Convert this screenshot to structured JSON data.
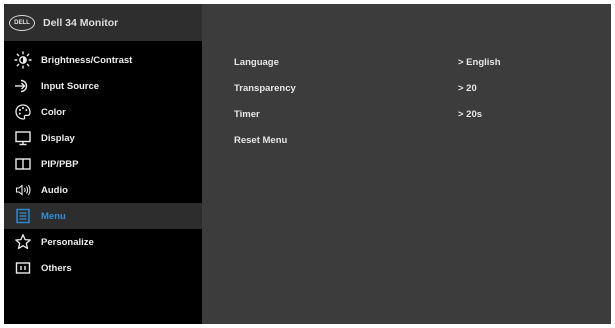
{
  "header": {
    "logo_text": "DELL",
    "title": "Dell 34 Monitor"
  },
  "sidebar": {
    "items": [
      {
        "label": "Brightness/Contrast",
        "icon": "brightness-icon"
      },
      {
        "label": "Input Source",
        "icon": "input-source-icon"
      },
      {
        "label": "Color",
        "icon": "color-icon"
      },
      {
        "label": "Display",
        "icon": "display-icon"
      },
      {
        "label": "PIP/PBP",
        "icon": "pip-pbp-icon"
      },
      {
        "label": "Audio",
        "icon": "audio-icon"
      },
      {
        "label": "Menu",
        "icon": "menu-icon",
        "selected": true
      },
      {
        "label": "Personalize",
        "icon": "star-icon"
      },
      {
        "label": "Others",
        "icon": "others-icon"
      }
    ]
  },
  "settings": [
    {
      "label": "Language",
      "value": "> English"
    },
    {
      "label": "Transparency",
      "value": "> 20"
    },
    {
      "label": "Timer",
      "value": "> 20s"
    },
    {
      "label": "Reset Menu",
      "value": ""
    }
  ],
  "colors": {
    "accent": "#2f8fd6",
    "background": "#000000",
    "panel": "#3c3c3c"
  }
}
